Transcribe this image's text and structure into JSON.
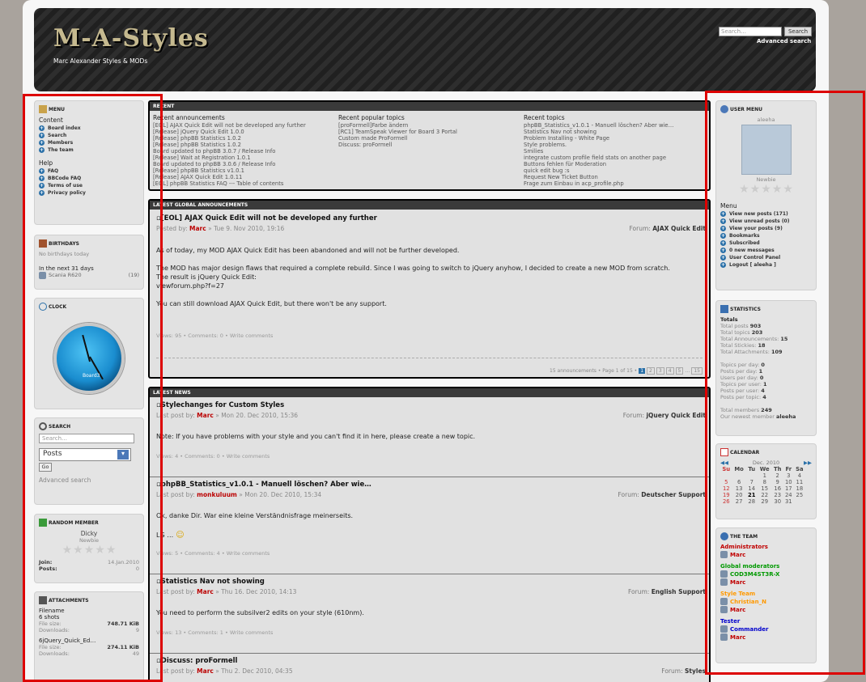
{
  "header": {
    "logo": "M-A-Styles",
    "tagline": "Marc Alexander Styles & MODs",
    "search_placeholder": "Search…",
    "search_button": "Search",
    "advanced": "Advanced search"
  },
  "left": {
    "menu": {
      "title": "MENU",
      "content_label": "Content",
      "content_items": [
        "Board index",
        "Search",
        "Members",
        "The team"
      ],
      "help_label": "Help",
      "help_items": [
        "FAQ",
        "BBCode FAQ",
        "Terms of use",
        "Privacy policy"
      ]
    },
    "birthdays": {
      "title": "BIRTHDAYS",
      "none": "No birthdays today",
      "next": "In the next 31 days",
      "person": "Scania R620",
      "age": "(19)"
    },
    "clock": {
      "title": "CLOCK",
      "face_label": "Board3"
    },
    "search": {
      "title": "SEARCH",
      "placeholder": "Search…",
      "select": "Posts",
      "go": "Go",
      "advanced": "Advanced search"
    },
    "random": {
      "title": "RANDOM MEMBER",
      "name": "Dicky",
      "rank": "Newbie",
      "join_label": "Join:",
      "join": "14.Jan.2010",
      "posts_label": "Posts:",
      "posts": "0"
    },
    "attachments": {
      "title": "ATTACHMENTS",
      "filename_label": "Filename",
      "items": [
        {
          "name": "6 shots",
          "size": "748.71 KiB",
          "downloads": "9"
        },
        {
          "name": "6jQuery_Quick_Ed…",
          "size": "274.11 KiB",
          "downloads": "49"
        }
      ],
      "size_label": "File size:",
      "dl_label": "Downloads:"
    }
  },
  "recent": {
    "title": "RECENT",
    "announcements": {
      "title": "Recent announcements",
      "items": [
        "[EOL] AJAX Quick Edit will not be developed any further",
        "[Release] jQuery Quick Edit 1.0.0",
        "[Release] phpBB Statistics 1.0.2",
        "[Release] phpBB Statistics 1.0.2",
        "Board updated to phpBB 3.0.7 / Release Info",
        "[Release] Wait at Registration 1.0.1",
        "Board updated to phpBB 3.0.6 / Release Info",
        "[Release] phpBB Statistics v1.0.1",
        "[Release] AJAX Quick Edit 1.0.11",
        "[EOL] phpBB Statistics FAQ --- Table of contents"
      ]
    },
    "popular": {
      "title": "Recent popular topics",
      "items": [
        "[proFormell]Farbe ändern",
        "[RC1] TeamSpeak Viewer for Board 3 Portal",
        "Custom made ProFormell",
        "Discuss: proFormell"
      ]
    },
    "topics": {
      "title": "Recent topics",
      "items": [
        "phpBB_Statistics_v1.0.1 - Manuell löschen? Aber wie…",
        "Statistics Nav not showing",
        "Problem Installing - White Page",
        "Style problems.",
        "Smilies",
        "integrate custom profile field stats on another page",
        "Buttons fehlen für Moderation",
        "quick edit bug :s",
        "Request New Ticket Button",
        "Frage zum Einbau in acp_profile.php"
      ]
    }
  },
  "global": {
    "title": "LATEST GLOBAL ANNOUNCEMENTS",
    "post": {
      "title": "[EOL] AJAX Quick Edit will not be developed any further",
      "posted_by": "Posted by:",
      "author": "Marc",
      "date": "» Tue 9. Nov 2010, 19:16",
      "forum_label": "Forum:",
      "forum": "AJAX Quick Edit",
      "p1": "As of today, my MOD AJAX Quick Edit has been abandoned and will not be further developed.",
      "p2": "The MOD has major design flaws that required a complete rebuild. Since I was going to switch to jQuery anyhow, I decided to create a new MOD from scratch.",
      "p3": "The result is jQuery Quick Edit:",
      "p4": "viewforum.php?f=27",
      "p5": "You can still download AJAX Quick Edit, but there won't be any support.",
      "foot": "Views: 95 • Comments: 0 • Write comments"
    },
    "pagination": "15 announcements • Page 1 of 15 •"
  },
  "news": {
    "title": "LATEST NEWS",
    "posts": [
      {
        "title": "Stylechanges for Custom Styles",
        "by": "Last post by:",
        "author": "Marc",
        "date": "» Mon 20. Dec 2010, 15:36",
        "forum": "jQuery Quick Edit",
        "body": "Note: If you have problems with your style and you can't find it in here, please create a new topic.",
        "foot": "Views: 4 • Comments: 0 • Write comments"
      },
      {
        "title": "phpBB_Statistics_v1.0.1 - Manuell löschen? Aber wie…",
        "by": "Last post by:",
        "author": "monkuluum",
        "date": "» Mon 20. Dec 2010, 15:34",
        "forum": "Deutscher Support",
        "body": "Ok, danke Dir. War eine kleine Verständnisfrage meinerseits.",
        "body2": "LG …",
        "foot": "Views: 5 • Comments: 4 • Write comments"
      },
      {
        "title": "Statistics Nav not showing",
        "by": "Last post by:",
        "author": "Marc",
        "date": "» Thu 16. Dec 2010, 14:13",
        "forum": "English Support",
        "body": "You need to perform the subsilver2 edits on your style (610nm).",
        "foot": "Views: 13 • Comments: 1 • Write comments"
      },
      {
        "title": "Discuss: proFormell",
        "by": "Last post by:",
        "author": "Marc",
        "date": "» Thu 2. Dec 2010, 04:35",
        "forum": "Styles"
      }
    ],
    "forum_label": "Forum:"
  },
  "right": {
    "usermenu": {
      "title": "USER MENU",
      "user": "aleeha",
      "rank": "Newbie",
      "menu_label": "Menu",
      "items": [
        "View new posts (171)",
        "View unread posts (0)",
        "View your posts (9)",
        "Bookmarks",
        "Subscribed",
        "0 new messages",
        "User Control Panel",
        "Logout [ aleeha ]"
      ]
    },
    "stats": {
      "title": "STATISTICS",
      "totals": "Totals",
      "rows": [
        [
          "Total posts",
          "903"
        ],
        [
          "Total topics",
          "203"
        ],
        [
          "Total Announcements:",
          "15"
        ],
        [
          "Total Stickies:",
          "18"
        ],
        [
          "Total Attachments:",
          "109"
        ]
      ],
      "rows2": [
        [
          "Topics per day:",
          "0"
        ],
        [
          "Posts per day:",
          "1"
        ],
        [
          "Users per day:",
          "0"
        ],
        [
          "Topics per user:",
          "1"
        ],
        [
          "Posts per user:",
          "4"
        ],
        [
          "Posts per topic:",
          "4"
        ]
      ],
      "members": "Total members",
      "members_v": "249",
      "newest": "Our newest member",
      "newest_v": "aleeha"
    },
    "calendar": {
      "title": "CALENDAR",
      "month": "Dec. 2010",
      "days": [
        "Su",
        "Mo",
        "Tu",
        "We",
        "Th",
        "Fr",
        "Sa"
      ],
      "weeks": [
        [
          "",
          "",
          "",
          "1",
          "2",
          "3",
          "4"
        ],
        [
          "5",
          "6",
          "7",
          "8",
          "9",
          "10",
          "11"
        ],
        [
          "12",
          "13",
          "14",
          "15",
          "16",
          "17",
          "18"
        ],
        [
          "19",
          "20",
          "21",
          "22",
          "23",
          "24",
          "25"
        ],
        [
          "26",
          "27",
          "28",
          "29",
          "30",
          "31",
          ""
        ]
      ]
    },
    "team": {
      "title": "THE TEAM",
      "groups": [
        {
          "name": "Administrators",
          "color": "#c00000",
          "members": [
            "Marc"
          ]
        },
        {
          "name": "Global moderators",
          "color": "#009900",
          "members": [
            "COD3M4ST3R-X",
            "Marc"
          ]
        },
        {
          "name": "Style Team",
          "color": "#ff9900",
          "members": [
            "Christian_N",
            "Marc"
          ]
        },
        {
          "name": "Tester",
          "color": "#0000cc",
          "members": [
            "Commander",
            "Marc"
          ]
        }
      ]
    }
  }
}
